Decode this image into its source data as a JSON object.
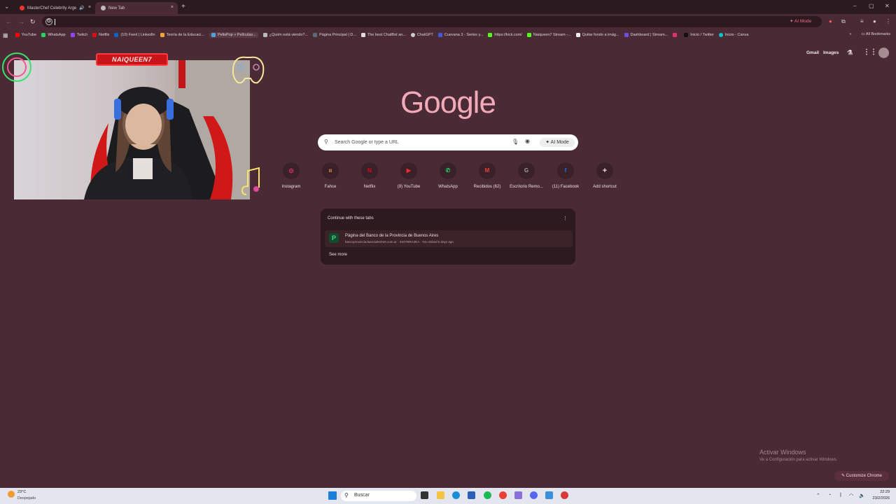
{
  "browser": {
    "tabs": [
      {
        "title": "MasterChef Celebrity Arge",
        "close": "×"
      },
      {
        "title": "New Tab",
        "close": "×"
      }
    ],
    "new_tab": "+",
    "window_controls": [
      "–",
      "▢",
      "✕"
    ],
    "ai_mode_button": "AI Mode",
    "bookmarks": [
      {
        "label": "YouTube",
        "color": "#ff0000"
      },
      {
        "label": "WhatsApp",
        "color": "#25d366"
      },
      {
        "label": "Twitch",
        "color": "#9146ff"
      },
      {
        "label": "Netflix",
        "color": "#e50914"
      },
      {
        "label": "(10) Feed | LinkedIn",
        "color": "#0a66c2"
      },
      {
        "label": "Teoría de la Educaci...",
        "color": "#f2a33a"
      },
      {
        "label": "PelisPop » Películas...",
        "color": "#4aa3df"
      },
      {
        "label": "¿Quién está viendo?...",
        "color": "#bbbbbb"
      },
      {
        "label": "Página Principal | D...",
        "color": "#5a6b7f"
      },
      {
        "label": "The best ChatBot an...",
        "color": "#dddddd"
      },
      {
        "label": "ChatGPT",
        "color": "#cccccc"
      },
      {
        "label": "Cuevana 3 - Series y...",
        "color": "#3b5bd9"
      },
      {
        "label": "https://kick.com/",
        "color": "#53fc18"
      },
      {
        "label": "Naiqueen7 Stream -...",
        "color": "#53fc18"
      },
      {
        "label": "Quitar fondo a imág...",
        "color": "#eeeeee"
      },
      {
        "label": "Dashboard | Stream...",
        "color": "#6c4fe0"
      },
      {
        "label": "",
        "color": "#e1306c"
      },
      {
        "label": "Inicio / Twitter",
        "color": "#111111"
      },
      {
        "label": "Inicio - Canva",
        "color": "#00c4cc"
      }
    ],
    "all_bookmarks": "All Bookmarks"
  },
  "google": {
    "gmail": "Gmail",
    "images": "Images",
    "logo": "Google",
    "search_placeholder": "Search Google or type a URL",
    "ai_mode": "AI Mode",
    "shortcuts": [
      {
        "label": "Instagram",
        "glyph": "◎",
        "color": "#e1306c"
      },
      {
        "label": "Fahce",
        "glyph": "ıı",
        "color": "#f09a3a"
      },
      {
        "label": "Netflix",
        "glyph": "N",
        "color": "#e50914"
      },
      {
        "label": "(9) YouTube",
        "glyph": "▶",
        "color": "#ff2a2a"
      },
      {
        "label": "WhatsApp",
        "glyph": "✆",
        "color": "#25d366"
      },
      {
        "label": "Recibidos (62)",
        "glyph": "M",
        "color": "#ea4335"
      },
      {
        "label": "Escritorio Remo...",
        "glyph": "G",
        "color": "#9aa0a6"
      },
      {
        "label": "(11) Facebook",
        "glyph": "f",
        "color": "#1877f2"
      },
      {
        "label": "Add shortcut",
        "glyph": "+",
        "color": "#e8d8dd"
      }
    ],
    "continue_title": "Continue with these tabs",
    "continue_item_title": "Página del Banco de la Provincia de Buenos Aires",
    "continue_item_sub": "bancoprovincia.bancainternet.com.ar · 2S0TBRA3EA · You visited 5 days ago",
    "see_more": "See more",
    "customize": "Customize Chrome"
  },
  "stream_overlay": {
    "banner": "NAIQUEEN7"
  },
  "windows": {
    "activate_title": "Activar Windows",
    "activate_sub": "Ve a Configuración para activar Windows.",
    "search": "Buscar",
    "weather_temp": "23°C",
    "weather_desc": "Despejado",
    "time": "22:29",
    "date": "23/2/2026"
  }
}
